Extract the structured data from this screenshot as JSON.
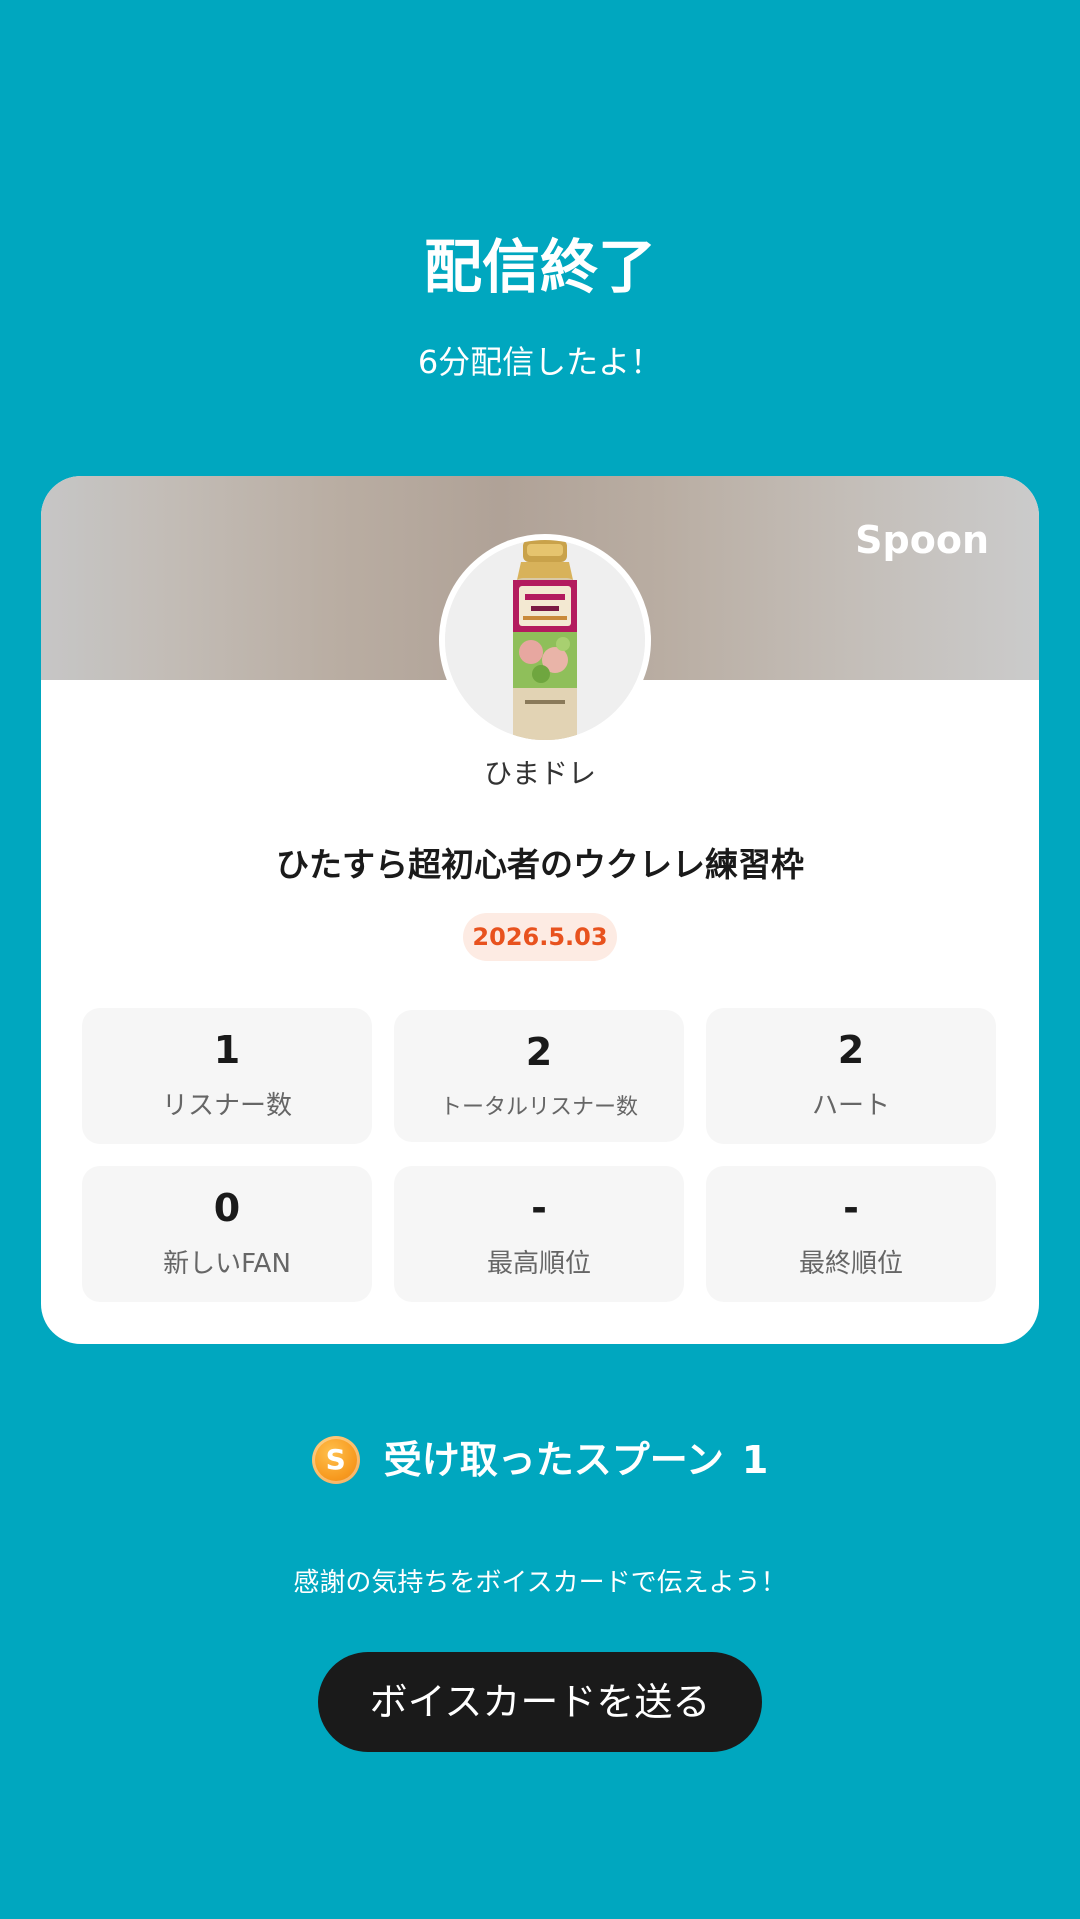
{
  "header": {
    "title": "配信終了",
    "subtitle": "6分配信したよ！"
  },
  "card": {
    "brand": "Spoon",
    "username": "ひまドレ",
    "live_title": "ひたすら超初心者のウクレレ練習枠",
    "date": "2026.5.03",
    "stats": [
      {
        "value": "1",
        "label": "リスナー数"
      },
      {
        "value": "2",
        "label": "トータルリスナー数"
      },
      {
        "value": "2",
        "label": "ハート"
      },
      {
        "value": "0",
        "label": "新しいFAN"
      },
      {
        "value": "-",
        "label": "最高順位"
      },
      {
        "value": "-",
        "label": "最終順位"
      }
    ]
  },
  "spoons": {
    "icon_letter": "S",
    "label": "受け取ったスプーン",
    "count": "1"
  },
  "thanks_text": "感謝の気持ちをボイスカードで伝えよう！",
  "voice_button_label": "ボイスカードを送る",
  "colors": {
    "background": "#00A7BF",
    "date_text": "#E8521E",
    "date_bg": "#FDEBE3",
    "button_bg": "#1A1A1A",
    "spoon_icon": "#F79A1F"
  }
}
